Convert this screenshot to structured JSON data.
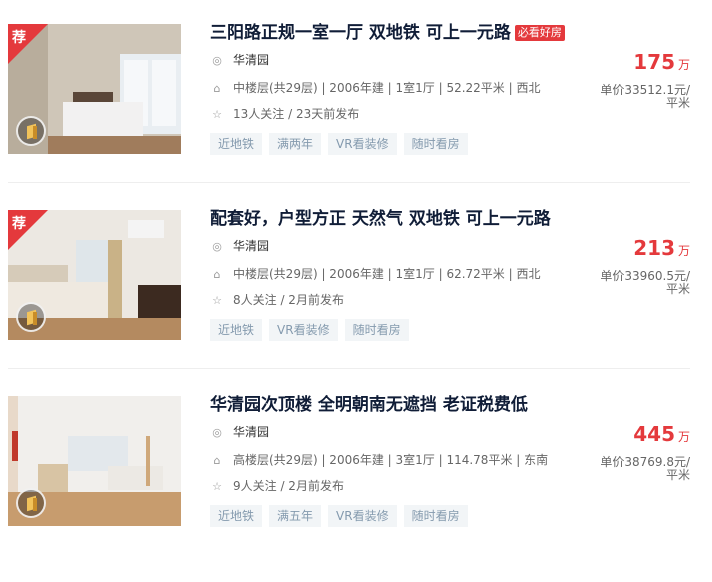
{
  "listings": [
    {
      "recommended": true,
      "recommend_label": "荐",
      "title": "三阳路正规一室一厅 双地铁 可上一元路",
      "badge": "必看好房",
      "community": "华清园",
      "house_info": "中楼层(共29层) | 2006年建 | 1室1厅 | 52.22平米 | 西北",
      "follow_info": "13人关注 / 23天前发布",
      "tags": [
        "近地铁",
        "满两年",
        "VR看装修",
        "随时看房"
      ],
      "total_price": "175",
      "price_unit": "万",
      "unit_price": "单价33512.1元/平米"
    },
    {
      "recommended": true,
      "recommend_label": "荐",
      "title": "配套好，户型方正 天然气 双地铁 可上一元路",
      "badge": "",
      "community": "华清园",
      "house_info": "中楼层(共29层) | 2006年建 | 1室1厅 | 62.72平米 | 西北",
      "follow_info": "8人关注 / 2月前发布",
      "tags": [
        "近地铁",
        "VR看装修",
        "随时看房"
      ],
      "total_price": "213",
      "price_unit": "万",
      "unit_price": "单价33960.5元/平米"
    },
    {
      "recommended": false,
      "recommend_label": "",
      "title": "华清园次顶楼 全明朝南无遮挡 老证税费低",
      "badge": "",
      "community": "华清园",
      "house_info": "高楼层(共29层) | 2006年建 | 3室1厅 | 114.78平米 | 东南",
      "follow_info": "9人关注 / 2月前发布",
      "tags": [
        "近地铁",
        "满五年",
        "VR看装修",
        "随时看房"
      ],
      "total_price": "445",
      "price_unit": "万",
      "unit_price": "单价38769.8元/平米"
    }
  ],
  "icons": {
    "location": "location-pin-icon",
    "house": "house-icon",
    "star": "star-icon",
    "vr": "vr-icon"
  },
  "colors": {
    "accent": "#e4393c",
    "title": "#101d37",
    "tag_bg": "#f2f5f7",
    "tag_text": "#849aae"
  }
}
